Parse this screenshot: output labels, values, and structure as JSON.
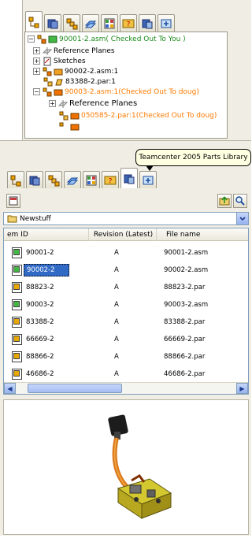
{
  "top_panel": {
    "tree": [
      {
        "label": "90001-2.asm( Checked Out To You )",
        "style": "green"
      },
      {
        "label": "Reference Planes",
        "style": "normal"
      },
      {
        "label": "Sketches",
        "style": "normal"
      },
      {
        "label": "90002-2.asm:1",
        "style": "normal"
      },
      {
        "label": "83388-2.par:1",
        "style": "normal"
      },
      {
        "label": "90003-2.asm:1(Checked Out To doug)",
        "style": "orange"
      },
      {
        "label": "Reference Planes",
        "style": "normal"
      },
      {
        "label": "050585-2.par:1(Checked Out To doug)",
        "style": "orange"
      }
    ]
  },
  "bottom_panel": {
    "tooltip": "Teamcenter 2005 Parts Library",
    "folder": "Newstuff",
    "columns": {
      "id": "em ID",
      "revision": "Revision (Latest)",
      "file": "File name"
    },
    "rows": [
      {
        "id": "90001-2",
        "rev": "A",
        "file": "90001-2.asm",
        "icon": "green"
      },
      {
        "id": "90002-2",
        "rev": "A",
        "file": "90002-2.asm",
        "icon": "green",
        "selected": true
      },
      {
        "id": "88823-2",
        "rev": "A",
        "file": "88823-2.par",
        "icon": "yellow"
      },
      {
        "id": "90003-2",
        "rev": "A",
        "file": "90003-2.asm",
        "icon": "green"
      },
      {
        "id": "83388-2",
        "rev": "A",
        "file": "83388-2.par",
        "icon": "yellow"
      },
      {
        "id": "66669-2",
        "rev": "A",
        "file": "66669-2.par",
        "icon": "yellow"
      },
      {
        "id": "88866-2",
        "rev": "A",
        "file": "88866-2.par",
        "icon": "yellow"
      },
      {
        "id": "46686-2",
        "rev": "A",
        "file": "46686-2.par",
        "icon": "yellow"
      }
    ]
  },
  "colors": {
    "panel_bg": "#f0eee4",
    "checked_out_you": "#1c8c1c",
    "checked_out_other": "#ff7a00",
    "selection": "#316ac5"
  },
  "icons": [
    "assembly-tab-icon",
    "parts-library-tab-icon",
    "layers-tab-icon",
    "feature-library-tab-icon",
    "family-of-parts-tab-icon",
    "help-tab-icon",
    "teamcenter-tab-icon",
    "add-in-tab-icon"
  ]
}
